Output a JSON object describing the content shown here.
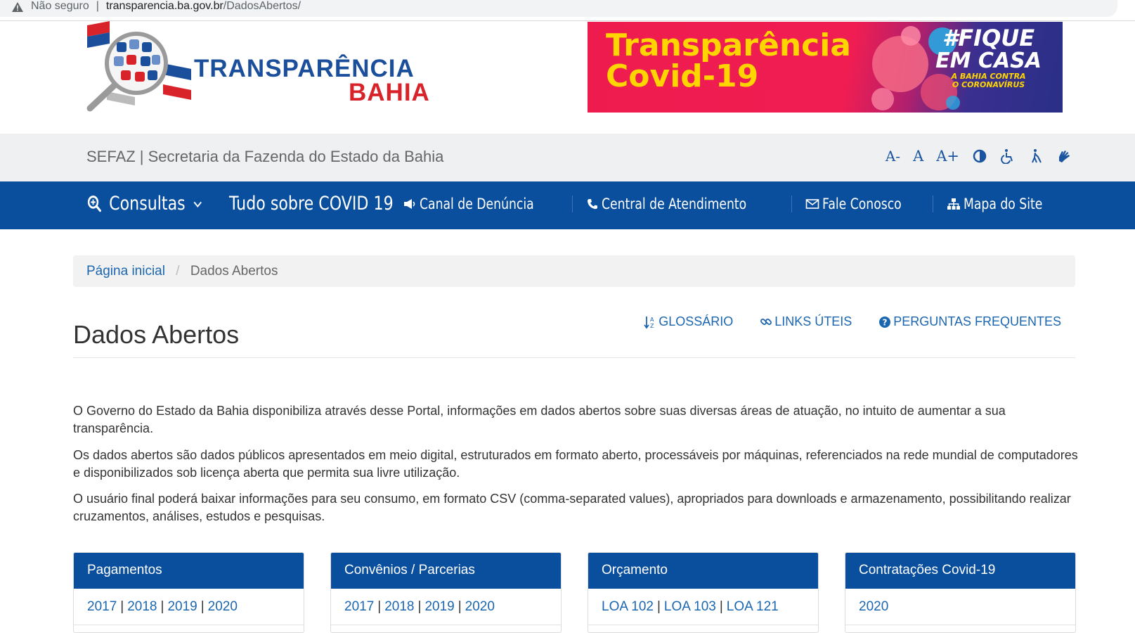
{
  "browser": {
    "security_label": "Não seguro",
    "url_host": "transparencia.ba.gov.br",
    "url_path": "/DadosAbertos/"
  },
  "header": {
    "logo_line1": "TRANSPARÊNCIA",
    "logo_line2": "BAHIA",
    "banner_title_line1": "Transparência",
    "banner_title_line2": "Covid-19",
    "banner_hashtag_line1": "#FIQUE",
    "banner_hashtag_line2": "EM CASA",
    "banner_hashtag_line3": "A BAHIA CONTRA",
    "banner_hashtag_line4": "O CORONAVÍRUS"
  },
  "sefaz_bar": {
    "text": "SEFAZ | Secretaria da Fazenda do Estado da Bahia",
    "font_decrease": "A-",
    "font_normal": "A",
    "font_increase": "A+"
  },
  "nav": {
    "consultas": "Consultas",
    "covid": "Tudo sobre COVID 19",
    "links": [
      {
        "label": "Canal de Denúncia"
      },
      {
        "label": "Central de Atendimento"
      },
      {
        "label": "Fale Conosco"
      },
      {
        "label": "Mapa do Site"
      }
    ]
  },
  "breadcrumb": {
    "home": "Página inicial",
    "separator": "/",
    "current": "Dados Abertos"
  },
  "page": {
    "title": "Dados Abertos",
    "glossario": "GLOSSÁRIO",
    "links_uteis": "LINKS ÚTEIS",
    "perguntas": "PERGUNTAS FREQUENTES",
    "paragraphs": [
      "O Governo do Estado da Bahia disponibiliza através desse Portal, informações em dados abertos sobre suas diversas áreas de atuação, no intuito de aumentar a sua transparência.",
      "Os dados abertos são dados públicos apresentados em meio digital, estruturados em formato aberto, processáveis por máquinas, referenciados na rede mundial de computadores e disponibilizados sob licença aberta que permita sua livre utilização.",
      "O usuário final poderá baixar informações para seu consumo, em formato CSV (comma-separated values), apropriados para downloads e armazenamento, possibilitando realizar cruzamentos, análises, estudos e pesquisas."
    ]
  },
  "cards": [
    {
      "title": "Pagamentos",
      "links": [
        "2017",
        "2018",
        "2019",
        "2020"
      ]
    },
    {
      "title": "Convênios / Parcerias",
      "links": [
        "2017",
        "2018",
        "2019",
        "2020"
      ]
    },
    {
      "title": "Orçamento",
      "links": [
        "LOA 102",
        "LOA 103",
        "LOA 121"
      ]
    },
    {
      "title": "Contratações Covid-19",
      "links": [
        "2020"
      ]
    }
  ],
  "colors": {
    "nav_blue": "#0a4f9e",
    "link_blue": "#1b66b0",
    "logo_red": "#d8232a",
    "banner_yellow": "#ffd500"
  }
}
